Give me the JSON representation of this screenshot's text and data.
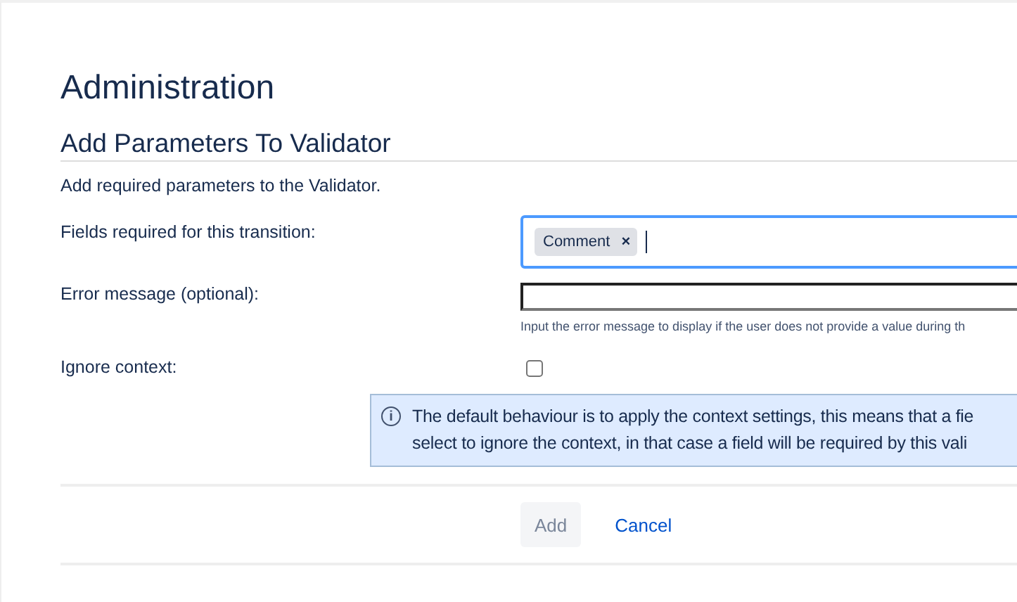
{
  "page_title": "Administration",
  "section_title": "Add Parameters To Validator",
  "description": "Add required parameters to the Validator.",
  "fields": [
    {
      "kind": "tags",
      "label": "Fields required for this transition:",
      "focused": true,
      "tags": [
        {
          "label": "Comment",
          "remove": "×"
        }
      ]
    },
    {
      "kind": "text",
      "label": "Error message (optional):",
      "hint": "Input the error message to display if the user does not provide a value during th"
    },
    {
      "kind": "checkbox",
      "label": "Ignore context:",
      "checked": false
    }
  ],
  "info": {
    "icon": "i",
    "lines": [
      "The default behaviour is to apply the context settings, this means that a fie",
      "select to ignore the context, in that case a field will be required by this vali"
    ]
  },
  "buttons": [
    {
      "kind": "primary",
      "label": "Add",
      "disabled": true
    },
    {
      "kind": "link",
      "label": "Cancel",
      "disabled": false
    }
  ]
}
